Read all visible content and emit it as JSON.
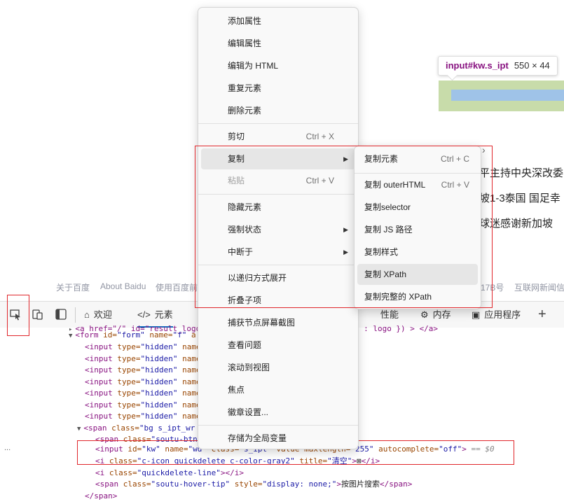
{
  "page": {
    "news": [
      "平主持中央深改委",
      "坡1-3泰国 国足幸",
      "球迷感谢新加坡"
    ],
    "footer_links": [
      "关于百度",
      "About Baidu",
      "使用百度前",
      "17B号",
      "互联网新闻信"
    ]
  },
  "inspect_tooltip": {
    "selector": "input#kw.s_ipt",
    "size": "550 × 44"
  },
  "devtools": {
    "tabs": [
      {
        "label": "欢迎",
        "icon": "home-icon"
      },
      {
        "label": "元素",
        "icon": "code-icon"
      },
      {
        "label": "性能",
        "icon": "performance-icon"
      },
      {
        "label": "内存",
        "icon": "memory-icon"
      },
      {
        "label": "应用程序",
        "icon": "application-icon"
      }
    ],
    "add_tab": "+",
    "dom_lines": {
      "l0": {
        "pre": "<a href=\"/\" id=\"result_logo\" ...",
        "post": "; tab : logo }) > </a>"
      },
      "l1": {
        "tag": "<form",
        "a1": " id=",
        "v1": "\"form\"",
        "a2": " name=",
        "v2": "\"f\"",
        "rest": " a"
      },
      "hidden": {
        "tag": "<input",
        "a1": " type=",
        "v1": "\"hidden\"",
        "a2": " name"
      },
      "span_bg": {
        "tag": "<span",
        "a1": " class=",
        "v1": "\"bg s_ipt_wr"
      },
      "soutu": {
        "tag": "<span",
        "a1": " class=",
        "v1": "\"soutu-btn\""
      },
      "input_kw": {
        "tag": "<input",
        "a1": " id=",
        "v1": "\"kw\"",
        "a2": " name=",
        "v2": "\"wd\"",
        "a3": " class=",
        "v3": "\"s_ipt\"",
        "a4": " value",
        "a5": " maxlength=",
        "v5": "\"255\"",
        "a6": " autocomplete=",
        "v6": "\"off\"",
        "end": ">",
        "eq": " == $0"
      },
      "quickdelete": {
        "tag": "<i",
        "a1": " class=",
        "v1": "\"c-icon quickdelete c-color-gray2\"",
        "a2": " title=",
        "v2": "\"清空\"",
        "mid": ">",
        "glyph": "⊠",
        "end": "</i>"
      },
      "qline": {
        "tag": "<i",
        "a1": " class=",
        "v1": "\"quickdelete-line\"",
        "end": "></i>"
      },
      "hovertip": {
        "tag": "<span",
        "a1": " class=",
        "v1": "\"soutu-hover-tip\"",
        "a2": " style=",
        "v2": "\"display: none;\"",
        "mid": ">",
        "text": "按图片搜索",
        "end": "</span>"
      },
      "span_close": "</span>"
    },
    "ellipsis": "..."
  },
  "context_menu": {
    "items": [
      {
        "label": "添加属性"
      },
      {
        "label": "编辑属性"
      },
      {
        "label": "编辑为 HTML"
      },
      {
        "label": "重复元素"
      },
      {
        "label": "删除元素"
      },
      {
        "label": "剪切",
        "shortcut": "Ctrl + X"
      },
      {
        "label": "复制"
      },
      {
        "label": "粘贴",
        "shortcut": "Ctrl + V"
      },
      {
        "label": "隐藏元素"
      },
      {
        "label": "强制状态"
      },
      {
        "label": "中断于"
      },
      {
        "label": "以递归方式展开"
      },
      {
        "label": "折叠子项"
      },
      {
        "label": "捕获节点屏幕截图"
      },
      {
        "label": "查看问题"
      },
      {
        "label": "滚动到视图"
      },
      {
        "label": "焦点"
      },
      {
        "label": "徽章设置..."
      },
      {
        "label": "存储为全局变量"
      }
    ]
  },
  "copy_submenu": {
    "items": [
      {
        "label": "复制元素",
        "shortcut": "Ctrl + C"
      },
      {
        "label": "复制 outerHTML",
        "shortcut": "Ctrl + V"
      },
      {
        "label": "复制selector"
      },
      {
        "label": "复制 JS 路径"
      },
      {
        "label": "复制样式"
      },
      {
        "label": "复制 XPath"
      },
      {
        "label": "复制完整的 XPath"
      }
    ]
  },
  "colors": {
    "accent": "#0f6cbd",
    "annotation": "#e0262b",
    "tag": "#881280",
    "attr": "#994500",
    "value": "#1a1aa6"
  }
}
